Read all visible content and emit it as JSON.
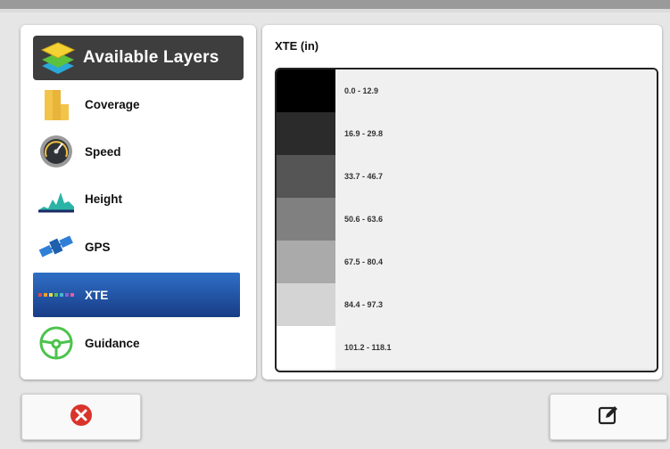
{
  "layers_panel": {
    "header": "Available Layers",
    "items": [
      {
        "label": "Coverage",
        "icon": "coverage-icon",
        "selected": false
      },
      {
        "label": "Speed",
        "icon": "speedometer-icon",
        "selected": false
      },
      {
        "label": "Height",
        "icon": "height-graph-icon",
        "selected": false
      },
      {
        "label": "GPS",
        "icon": "satellite-icon",
        "selected": false
      },
      {
        "label": "XTE",
        "icon": "xte-icon",
        "selected": true
      },
      {
        "label": "Guidance",
        "icon": "steering-wheel-icon",
        "selected": false
      }
    ]
  },
  "legend": {
    "title": "XTE (in)",
    "rows": [
      {
        "range": "0.0  -  12.9",
        "color": "#000000"
      },
      {
        "range": "16.9  -  29.8",
        "color": "#2b2b2b"
      },
      {
        "range": "33.7  -  46.7",
        "color": "#555555"
      },
      {
        "range": "50.6  -  63.6",
        "color": "#808080"
      },
      {
        "range": "67.5  -  80.4",
        "color": "#aaaaaa"
      },
      {
        "range": "84.4  -  97.3",
        "color": "#d4d4d4"
      },
      {
        "range": "101.2  -  118.1",
        "color": "#ffffff"
      }
    ]
  },
  "footer": {
    "close_icon": "close-icon",
    "edit_icon": "edit-icon",
    "colors": {
      "close": "#d9342b",
      "selection": "#1f4fa0"
    }
  }
}
